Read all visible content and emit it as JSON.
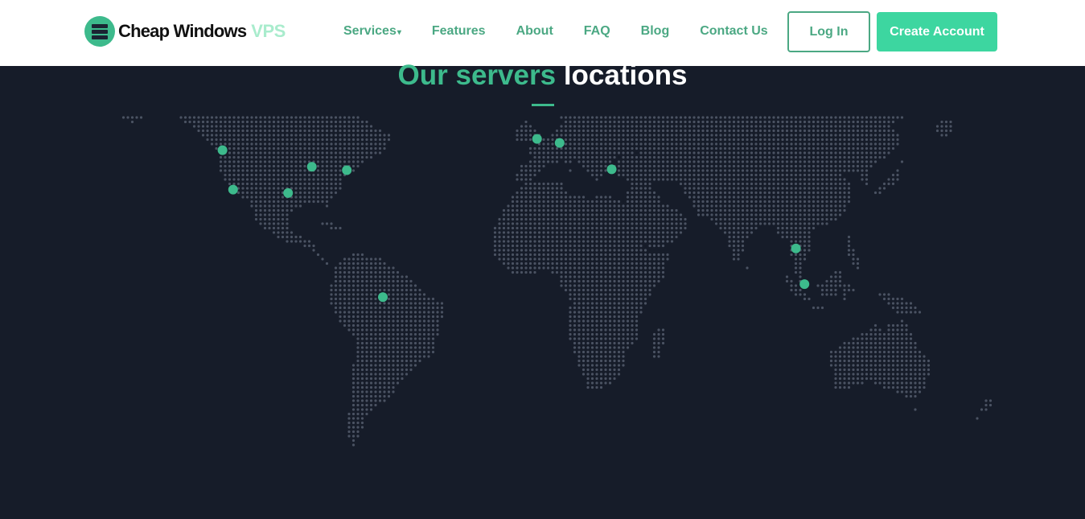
{
  "header": {
    "logo_text": "Cheap Windows",
    "logo_accent": "VPS",
    "logo_icon": "server-stack-icon",
    "nav": [
      {
        "label": "Services",
        "has_dropdown": true
      },
      {
        "label": "Features"
      },
      {
        "label": "About"
      },
      {
        "label": "FAQ"
      },
      {
        "label": "Blog"
      },
      {
        "label": "Contact Us"
      }
    ],
    "login_label": "Log In",
    "create_account_label": "Create Account"
  },
  "section": {
    "heading_part1": "Our servers",
    "heading_part2": "locations"
  },
  "colors": {
    "accent": "#3dba8c",
    "button_fill": "#3dd6a0",
    "background": "#161c29",
    "map_dots": "#4a5262"
  },
  "map": {
    "server_locations": [
      {
        "lat": 47.6,
        "lon": -122.3
      },
      {
        "lat": 34.0,
        "lon": -118.2
      },
      {
        "lat": 41.9,
        "lon": -87.6
      },
      {
        "lat": 40.7,
        "lon": -74.0
      },
      {
        "lat": 32.8,
        "lon": -96.8
      },
      {
        "lat": -3.1,
        "lon": -60.0
      },
      {
        "lat": 51.5,
        "lon": -0.1
      },
      {
        "lat": 50.1,
        "lon": 8.7
      },
      {
        "lat": 41.0,
        "lon": 28.9
      },
      {
        "lat": 13.7,
        "lon": 100.5
      },
      {
        "lat": 1.35,
        "lon": 103.8
      }
    ]
  }
}
